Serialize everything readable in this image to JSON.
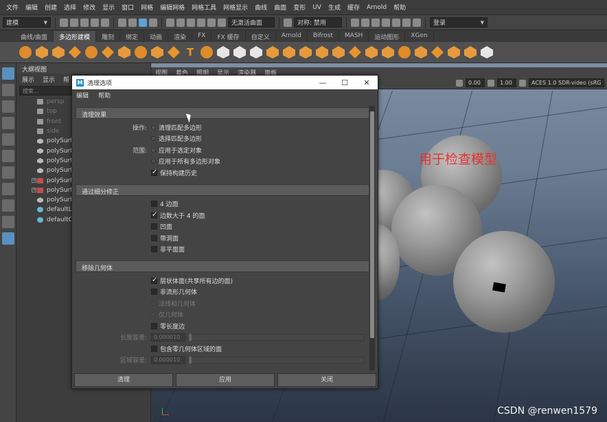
{
  "menubar": [
    "文件",
    "编辑",
    "创建",
    "选择",
    "修改",
    "显示",
    "窗口",
    "网格",
    "编辑网格",
    "网格工具",
    "网格显示",
    "曲线",
    "曲面",
    "变形",
    "UV",
    "生成",
    "缓存",
    "Arnold",
    "帮助"
  ],
  "statusline": {
    "mode": "建模",
    "no_live_surface": "无激活曲面",
    "symmetry": "对称: 禁用",
    "login": "登录"
  },
  "shelf_tabs": [
    "曲线/曲面",
    "多边形建模",
    "雕刻",
    "绑定",
    "动画",
    "渲染",
    "FX",
    "FX 缓存",
    "自定义",
    "Arnold",
    "Bifrost",
    "MASH",
    "运动图形",
    "XGen"
  ],
  "shelf_active": "多边形建模",
  "outliner": {
    "title": "大纲视图",
    "menus": [
      "展示",
      "显示",
      "帮"
    ],
    "search_placeholder": "搜索...",
    "items": [
      {
        "label": "persp",
        "dim": true,
        "icon": "camera-icon"
      },
      {
        "label": "top",
        "dim": true,
        "icon": "camera-icon"
      },
      {
        "label": "front",
        "dim": true,
        "icon": "camera-icon"
      },
      {
        "label": "side",
        "dim": true,
        "icon": "camera-icon"
      },
      {
        "label": "polySurf",
        "dim": false,
        "icon": "mesh-icon"
      },
      {
        "label": "polySurf",
        "dim": false,
        "icon": "mesh-icon"
      },
      {
        "label": "polySurf",
        "dim": false,
        "icon": "mesh-icon"
      },
      {
        "label": "polySurf",
        "dim": false,
        "icon": "mesh-icon"
      },
      {
        "label": "polySurf",
        "dim": false,
        "icon": "group-icon",
        "expand": true
      },
      {
        "label": "polySurf",
        "dim": false,
        "icon": "group-icon",
        "expand": true
      },
      {
        "label": "polySurf",
        "dim": false,
        "icon": "mesh-icon"
      },
      {
        "label": "defaultLi",
        "dim": false,
        "icon": "set-icon"
      },
      {
        "label": "defaultC",
        "dim": false,
        "icon": "set-icon"
      }
    ]
  },
  "viewport": {
    "menus": [
      "视图",
      "着色",
      "照明",
      "显示",
      "渲染器",
      "面板"
    ],
    "field1": "0.00",
    "field2": "1.00",
    "colorspace": "ACES 1.0 SDR-video (sRG",
    "annotation": "用于检查模型"
  },
  "dialog": {
    "title": "清理选项",
    "menus": [
      "编辑",
      "帮助"
    ],
    "win_buttons": [
      "—",
      "☐",
      "✕"
    ],
    "sections": {
      "cleanup_effect": "清理效果",
      "fix_by_tess": "通过细分修正",
      "remove_geo": "移除几何体"
    },
    "operation_label": "操作:",
    "operation_options": [
      "清理匹配多边形",
      "选择匹配多边形"
    ],
    "scope_label": "范围:",
    "scope_options": [
      "应用于选定对象",
      "应用于所有多边形对象"
    ],
    "keep_history": "保持构建历史",
    "tess_options": [
      {
        "label": "4 边面",
        "checked": false
      },
      {
        "label": "边数大于 4 的面",
        "checked": true
      },
      {
        "label": "凹面",
        "checked": false
      },
      {
        "label": "带洞面",
        "checked": false
      },
      {
        "label": "非平面面",
        "checked": false
      }
    ],
    "lamina": "层状体面(共享所有边的面)",
    "nonmanifold": "非流形几何体",
    "normals_geo": "法线和几何体",
    "geo_only": "仅几何体",
    "zero_length_edges": "零长度边",
    "length_tol_label": "长度容差:",
    "length_tol_value": "0.000010",
    "zero_geo_faces": "包含零几何体区域的面",
    "area_tol_label": "区域容差:",
    "area_tol_value": "0.000010",
    "buttons": [
      "清理",
      "应用",
      "关闭"
    ]
  },
  "watermark": "CSDN @renwen1579"
}
